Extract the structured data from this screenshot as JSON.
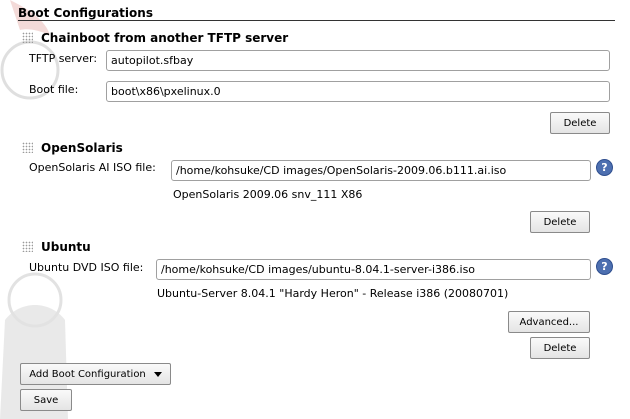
{
  "header": {
    "title": "Boot Configurations"
  },
  "chainboot": {
    "title": "Chainboot from another TFTP server",
    "tftp_label": "TFTP server:",
    "tftp_value": "autopilot.sfbay",
    "boot_label": "Boot file:",
    "boot_value": "boot\\x86\\pxelinux.0",
    "delete_label": "Delete"
  },
  "opensolaris": {
    "title": "OpenSolaris",
    "iso_label": "OpenSolaris AI ISO file:",
    "iso_value": "/home/kohsuke/CD images/OpenSolaris-2009.06.b111.ai.iso",
    "description": "OpenSolaris 2009.06 snv_111 X86",
    "help_symbol": "?",
    "delete_label": "Delete"
  },
  "ubuntu": {
    "title": "Ubuntu",
    "iso_label": "Ubuntu DVD ISO file:",
    "iso_value": "/home/kohsuke/CD images/ubuntu-8.04.1-server-i386.iso",
    "description": "Ubuntu-Server 8.04.1 \"Hardy Heron\" - Release i386 (20080701)",
    "help_symbol": "?",
    "advanced_label": "Advanced...",
    "delete_label": "Delete"
  },
  "footer": {
    "add_label": "Add Boot Configuration",
    "save_label": "Save"
  }
}
